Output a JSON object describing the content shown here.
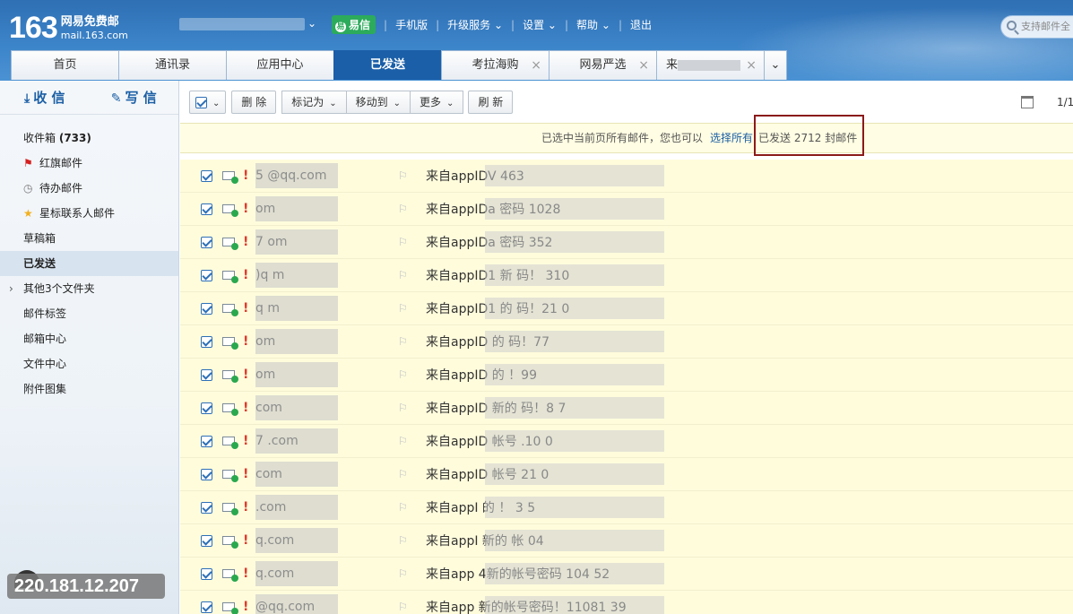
{
  "header": {
    "logo_num": "163",
    "logo_line1": "网易免费邮",
    "logo_line2": "mail.163.com",
    "nav": [
      "易信",
      "手机版",
      "升级服务",
      "设置",
      "帮助",
      "退出"
    ],
    "search_placeholder": "支持邮件全"
  },
  "tabs": [
    {
      "label": "首页"
    },
    {
      "label": "通讯录"
    },
    {
      "label": "应用中心"
    },
    {
      "label": "已发送"
    },
    {
      "label": "考拉海购"
    },
    {
      "label": "网易严选"
    },
    {
      "label": "来"
    }
  ],
  "sidebar": {
    "receive_label": "收 信",
    "compose_label": "写 信",
    "inbox": {
      "label": "收件箱",
      "count": "(733)"
    },
    "folders": [
      {
        "label": "红旗邮件"
      },
      {
        "label": "待办邮件"
      },
      {
        "label": "星标联系人邮件"
      },
      {
        "label": "草稿箱"
      },
      {
        "label": "已发送"
      },
      {
        "label": "其他3个文件夹"
      },
      {
        "label": "邮件标签"
      },
      {
        "label": "邮箱中心"
      },
      {
        "label": "文件中心"
      },
      {
        "label": "附件图集"
      }
    ],
    "ip": "220.181.12.207"
  },
  "toolbar": {
    "delete": "删 除",
    "mark_as": "标记为",
    "move_to": "移动到",
    "more": "更多",
    "refresh": "刷 新",
    "page": "1/1"
  },
  "notice": {
    "text": "已选中当前页所有邮件，您也可以",
    "link": "选择所有",
    "count": "已发送 2712 封邮件"
  },
  "rows": [
    {
      "to": "5    @qq.com",
      "subject": "来自appIDV                         463"
    },
    {
      "to": "            om",
      "subject": "来自appIDa         密码          1028"
    },
    {
      "to": "7           om",
      "subject": "来自appIDa         密码           352"
    },
    {
      "to": "           )q   m",
      "subject": "来自appID1    新     码！       310"
    },
    {
      "to": "           q   m",
      "subject": "来自appID1    的      码！21       0"
    },
    {
      "to": "           om",
      "subject": "来自appID    的      码！77"
    },
    {
      "to": "           om",
      "subject": "来自appID    的        ！99"
    },
    {
      "to": "           com",
      "subject": "来自appID    新的      码！8        7"
    },
    {
      "to": "7          .com",
      "subject": "来自appID    帐号      .10       0"
    },
    {
      "to": "           com",
      "subject": "来自appID    帐号      21        0"
    },
    {
      "to": "          .com",
      "subject": "来自appI     的       ！     3     5"
    },
    {
      "to": "          q.com",
      "subject": "来自appI    新的        帐    04"
    },
    {
      "to": "          q.com",
      "subject": "来自app    4新的帐号密码        104      52"
    },
    {
      "to": "          @qq.com",
      "subject": "来自app    新的帐号密码！11081      39"
    }
  ]
}
